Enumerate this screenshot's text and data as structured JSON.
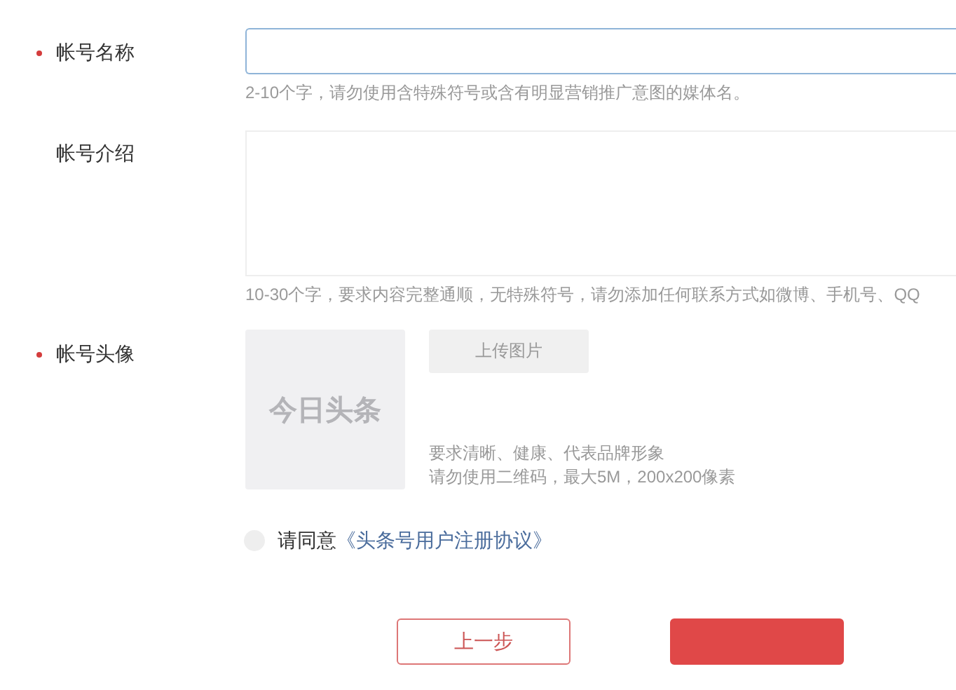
{
  "fields": [
    {
      "kind": "input",
      "label": "帐号名称",
      "required": true,
      "hint": "2-10个字，请勿使用含特殊符号或含有明显营销推广意图的媒体名。"
    },
    {
      "kind": "textarea",
      "label": "帐号介绍",
      "required": false,
      "hint": "10-30个字，要求内容完整通顺，无特殊符号，请勿添加任何联系方式如微博、手机号、QQ"
    },
    {
      "kind": "avatar",
      "label": "帐号头像",
      "required": true,
      "placeholder_text": "今日头条",
      "upload_button": "上传图片",
      "requirements": [
        "要求清晰、健康、代表品牌形象",
        "请勿使用二维码，最大5M，200x200像素"
      ]
    }
  ],
  "agreement": {
    "checked": false,
    "text": "请同意",
    "link": "《头条号用户注册协议》"
  },
  "buttons": [
    {
      "kind": "secondary",
      "label": "上一步"
    },
    {
      "kind": "primary"
    }
  ]
}
